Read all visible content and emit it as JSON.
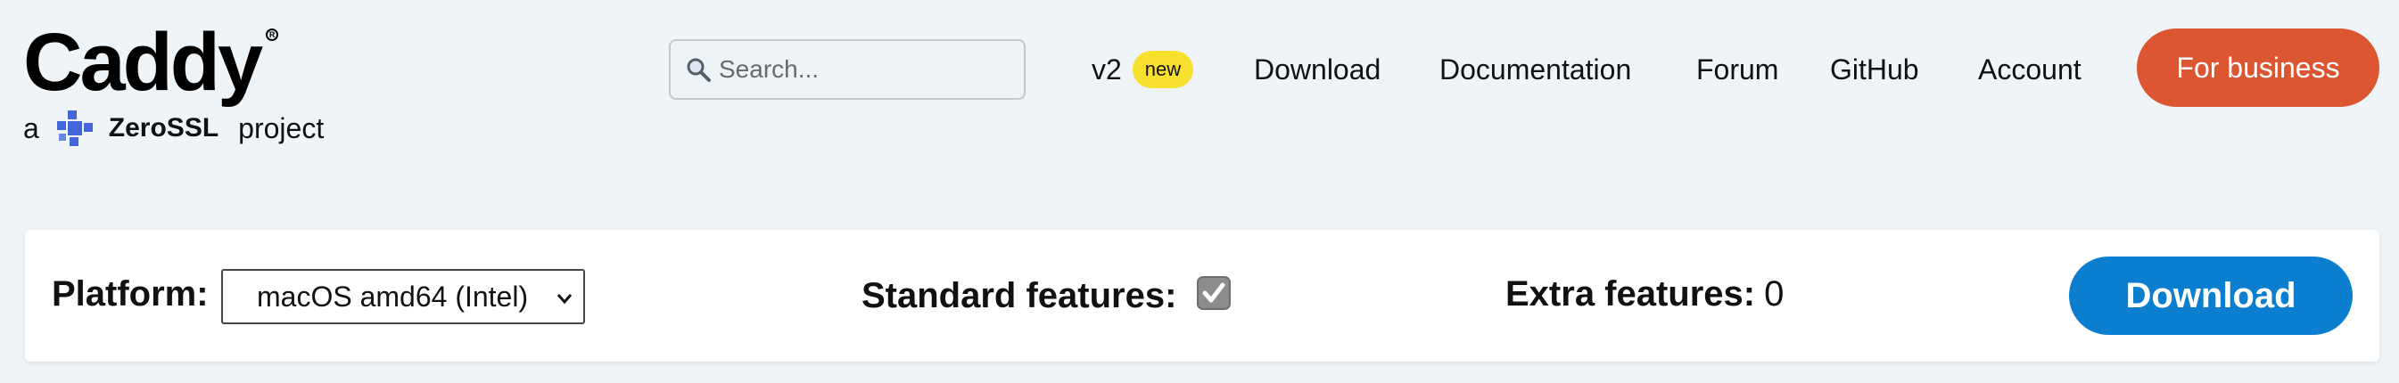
{
  "brand": {
    "name": "Caddy",
    "byline_prefix": "a",
    "partner": "ZeroSSL",
    "byline_suffix": "project"
  },
  "search": {
    "placeholder": "Search..."
  },
  "nav": {
    "version": "v2",
    "version_badge": "new",
    "download": "Download",
    "documentation": "Documentation",
    "forum": "Forum",
    "github": "GitHub",
    "account": "Account",
    "business": "For business"
  },
  "panel": {
    "platform_label": "Platform:",
    "platform_value": "macOS amd64 (Intel)",
    "standard_label": "Standard features:",
    "standard_checked": true,
    "extra_label": "Extra features:",
    "extra_count": "0",
    "download_label": "Download"
  },
  "colors": {
    "background": "#eff4f8",
    "business_button": "#dd5632",
    "download_button": "#0b7ecf",
    "badge": "#f8e12e",
    "zerossl_brand": "#4266d9"
  }
}
